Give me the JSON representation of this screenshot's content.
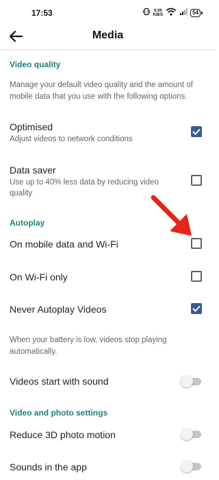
{
  "status_bar": {
    "time": "17:53",
    "speed_value": "0.00",
    "speed_unit": "KB/S",
    "battery": "54",
    "icons": [
      "vibrate-icon",
      "wifi-icon",
      "signal-icon",
      "battery-icon"
    ]
  },
  "app_bar": {
    "title": "Media",
    "back_icon": "arrow-left-icon"
  },
  "video_quality": {
    "header": "Video quality",
    "description": "Manage your default video quality and the amount of mobile data that you use with the following options.",
    "optimised_title": "Optimised",
    "optimised_sub": "Adjust videos to network conditions",
    "optimised_checked": true,
    "datasaver_title": "Data saver",
    "datasaver_sub": "Use up to 40% less data by reducing video quality",
    "datasaver_checked": false
  },
  "autoplay": {
    "header": "Autoplay",
    "mobile_wifi_label": "On mobile data and Wi-Fi",
    "mobile_wifi_checked": false,
    "wifi_only_label": "On Wi-Fi only",
    "wifi_only_checked": false,
    "never_label": "Never Autoplay Videos",
    "never_checked": true,
    "battery_note": "When your battery is low, videos stop playing automatically.",
    "sound_label": "Videos start with sound",
    "sound_on": false
  },
  "video_photo": {
    "header": "Video and photo settings",
    "reduce3d_label": "Reduce 3D photo motion",
    "reduce3d_on": false,
    "sounds_label": "Sounds in the app",
    "sounds_on": false
  },
  "colors": {
    "section_header": "#1b7f79",
    "checkbox_checked": "#3a5a98",
    "annotation_arrow": "#e8231a"
  }
}
